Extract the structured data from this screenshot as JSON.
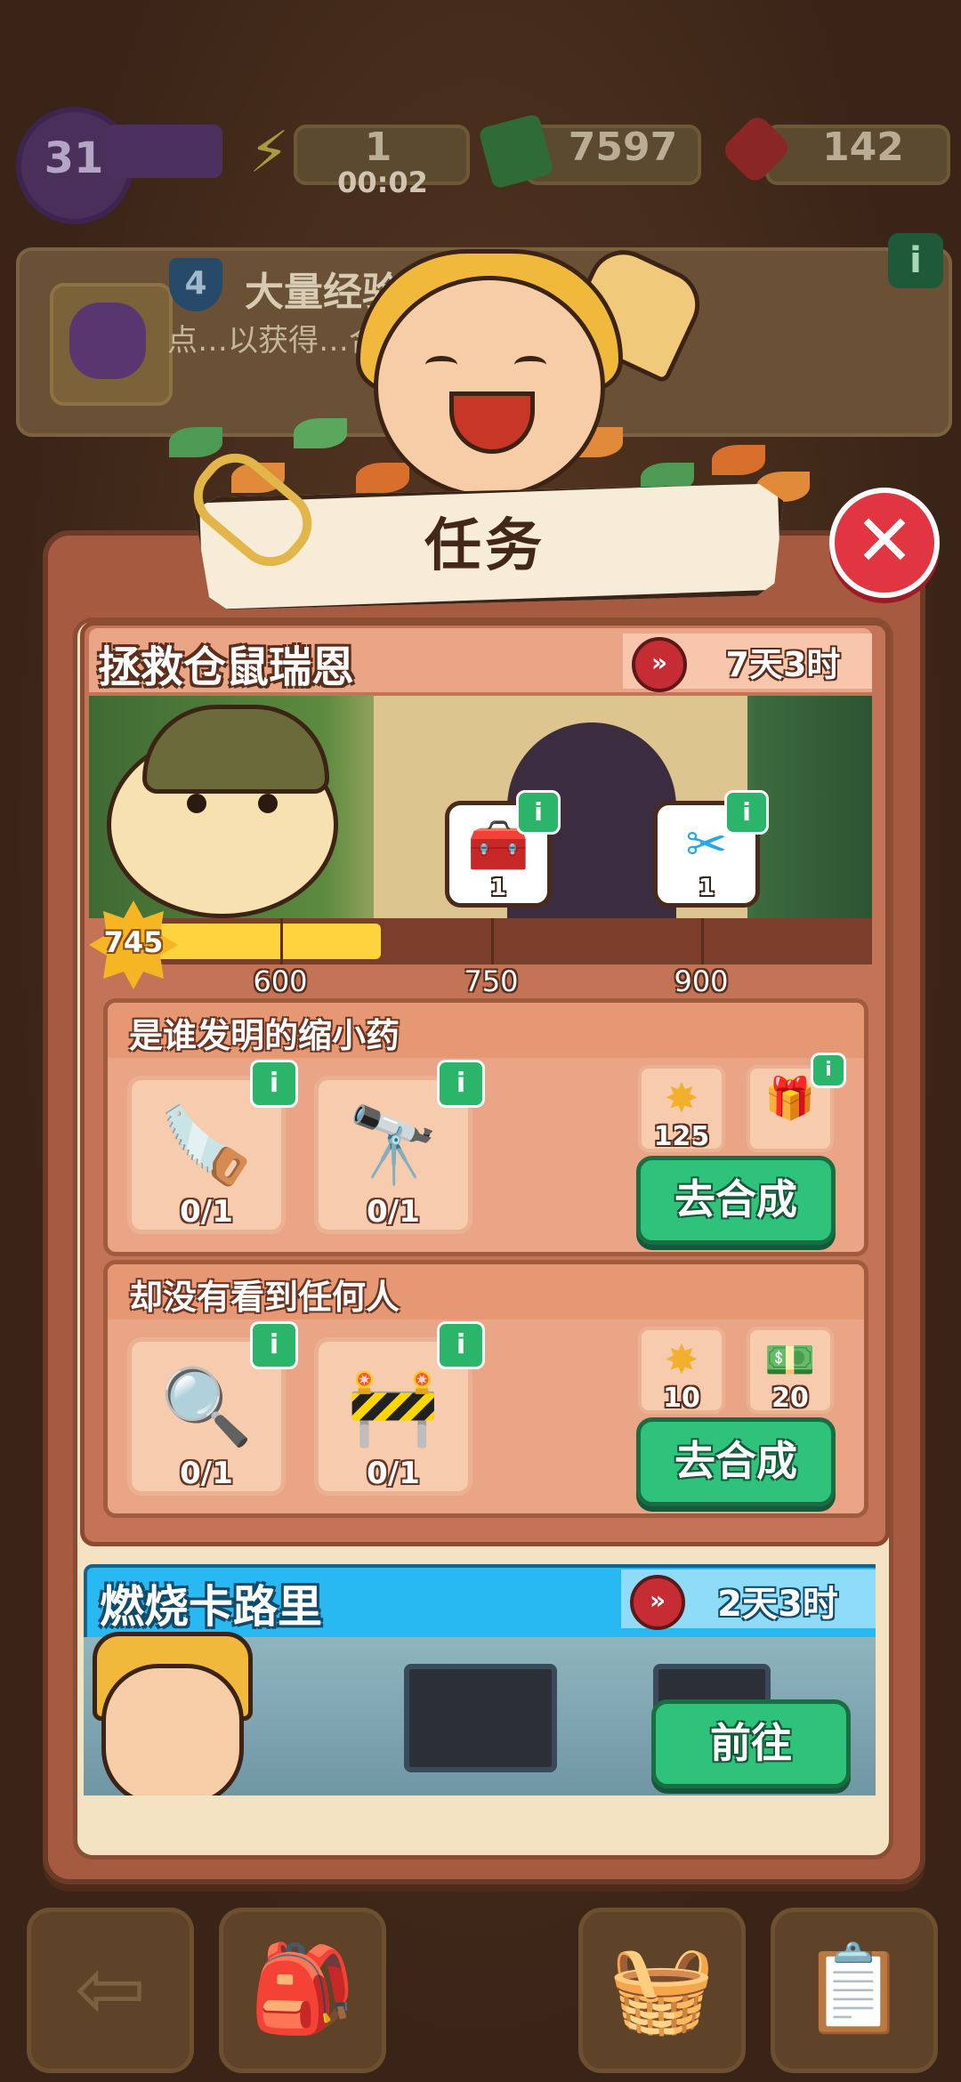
{
  "hud": {
    "level": "31",
    "energy": "1",
    "energy_timer": "00:02",
    "cash": "7597",
    "gems": "142",
    "info_label": "i"
  },
  "background_quest": {
    "badge_number": "4",
    "title": "大量经验",
    "description": "点…以获得…合成…多。"
  },
  "dialog": {
    "title": "任务",
    "close_label": "✕"
  },
  "quest1": {
    "title": "拯救仓鼠瑞恩",
    "time_left": "7天3时",
    "clock_glyph": "»",
    "progress_value": "745",
    "progress_fraction": 0.35,
    "milestones": [
      "600",
      "750",
      "900"
    ],
    "milestone_rewards": [
      {
        "icon": "treasure-chest-icon",
        "glyph": "🧰",
        "count": "1"
      },
      {
        "icon": "scissors-icon",
        "glyph": "✂",
        "count": "1"
      }
    ],
    "subtasks": [
      {
        "title": "是谁发明的缩小药",
        "items": [
          {
            "icon": "saw-icon",
            "glyph": "🪚",
            "count": "0/1"
          },
          {
            "icon": "telescope-icon",
            "glyph": "🔭",
            "count": "0/1"
          }
        ],
        "rewards": [
          {
            "icon": "star-badge-icon",
            "glyph": "✸",
            "count": "125"
          },
          {
            "icon": "gift-box-icon",
            "glyph": "🎁",
            "count": ""
          }
        ],
        "button": "去合成"
      },
      {
        "title": "却没有看到任何人",
        "items": [
          {
            "icon": "magnifier-icon",
            "glyph": "🔍",
            "count": "0/1"
          },
          {
            "icon": "danger-barrier-icon",
            "glyph": "🚧",
            "count": "0/1"
          }
        ],
        "rewards": [
          {
            "icon": "star-badge-icon",
            "glyph": "✸",
            "count": "10"
          },
          {
            "icon": "cash-icon",
            "glyph": "💵",
            "count": "20"
          }
        ],
        "button": "去合成"
      }
    ]
  },
  "quest2": {
    "title": "燃烧卡路里",
    "time_left": "2天3时",
    "clock_glyph": "»",
    "button": "前往"
  },
  "bottom_nav": [
    {
      "icon": "back-arrow-icon",
      "glyph": "⇦"
    },
    {
      "icon": "backpack-icon",
      "glyph": "🎒"
    },
    {
      "icon": "basket-icon",
      "glyph": "🧺"
    },
    {
      "icon": "quest-clipboard-icon",
      "glyph": "📋"
    }
  ],
  "colors": {
    "dialog_frame": "#a65a3f",
    "dialog_inner": "#f4e3c3",
    "go_button": "#2fc27a",
    "quest2_header": "#28b8f2",
    "progress_fill": "#ffd33d",
    "close_button": "#e23542"
  }
}
